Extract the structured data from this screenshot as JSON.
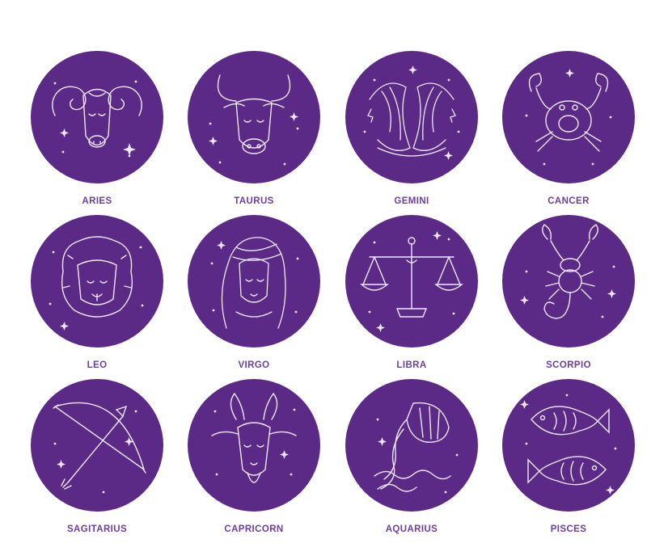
{
  "colors": {
    "badge": "#5b2a86",
    "line": "#f1e7ff",
    "label": "#6b3fa0",
    "background": "#ffffff"
  },
  "signs": [
    {
      "label": "ARIES",
      "icon": "ram-icon"
    },
    {
      "label": "TAURUS",
      "icon": "bull-icon"
    },
    {
      "label": "GEMINI",
      "icon": "twins-icon"
    },
    {
      "label": "CANCER",
      "icon": "crab-icon"
    },
    {
      "label": "LEO",
      "icon": "lion-icon"
    },
    {
      "label": "VIRGO",
      "icon": "maiden-icon"
    },
    {
      "label": "LIBRA",
      "icon": "scales-icon"
    },
    {
      "label": "SCORPIO",
      "icon": "scorpion-icon"
    },
    {
      "label": "SAGITARIUS",
      "icon": "bow-arrow-icon"
    },
    {
      "label": "CAPRICORN",
      "icon": "goat-icon"
    },
    {
      "label": "AQUARIUS",
      "icon": "water-bearer-icon"
    },
    {
      "label": "PISCES",
      "icon": "fish-icon"
    }
  ]
}
